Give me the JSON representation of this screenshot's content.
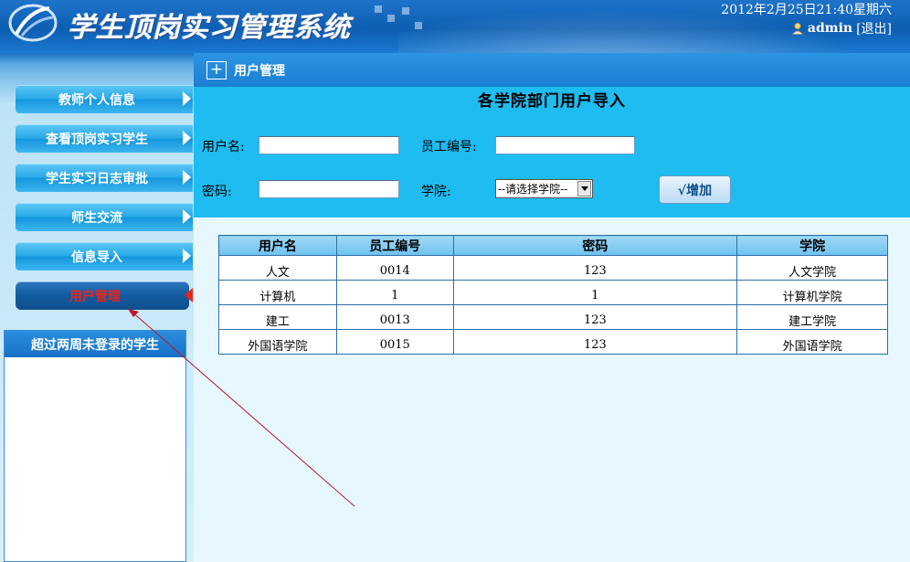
{
  "header": {
    "app_title": "学生顶岗实习管理系统",
    "datetime": "2012年2月25日21:40星期六",
    "username": "admin",
    "logout_label": "[退出]"
  },
  "sidebar": {
    "items": [
      {
        "label": "教师个人信息"
      },
      {
        "label": "查看顶岗实习学生"
      },
      {
        "label": "学生实习日志审批"
      },
      {
        "label": "师生交流"
      },
      {
        "label": "信息导入"
      },
      {
        "label": "用户管理",
        "active": true
      }
    ],
    "inactive_panel_title": "超过两周未登录的学生"
  },
  "main": {
    "section_title": "用户管理",
    "form_title": "各学院部门用户导入",
    "labels": {
      "username": "用户名:",
      "employee_id": "员工编号:",
      "password": "密码:",
      "college": "学院:"
    },
    "college_select": {
      "selected": "--请选择学院--"
    },
    "add_button": "√增加",
    "table": {
      "headers": [
        "用户名",
        "员工编号",
        "密码",
        "学院"
      ],
      "rows": [
        [
          "人文",
          "0014",
          "123",
          "人文学院"
        ],
        [
          "计算机",
          "1",
          "1",
          "计算机学院"
        ],
        [
          "建工",
          "0013",
          "123",
          "建工学院"
        ],
        [
          "外国语学院",
          "0015",
          "123",
          "外国语学院"
        ]
      ]
    }
  },
  "colors": {
    "header_blue": "#0d5eb3",
    "form_cyan": "#1ebcf0",
    "active_menu_text": "#e8241c",
    "annotation_arrow": "#c0142a"
  }
}
